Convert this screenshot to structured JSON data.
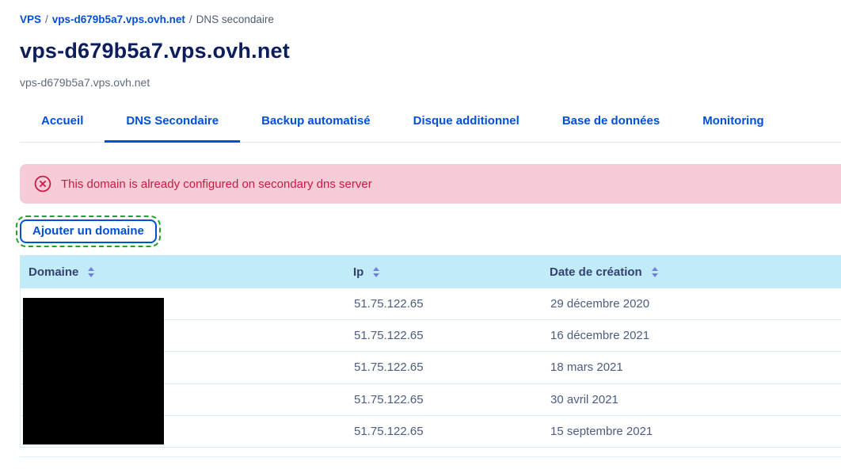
{
  "breadcrumb": {
    "separator": "/",
    "items": [
      {
        "label": "VPS",
        "type": "link"
      },
      {
        "label": "vps-d679b5a7.vps.ovh.net",
        "type": "link"
      },
      {
        "label": "DNS secondaire",
        "type": "current"
      }
    ]
  },
  "header": {
    "title": "vps-d679b5a7.vps.ovh.net",
    "subtitle": "vps-d679b5a7.vps.ovh.net"
  },
  "tabs": [
    {
      "label": "Accueil",
      "active": false
    },
    {
      "label": "DNS Secondaire",
      "active": true
    },
    {
      "label": "Backup automatisé",
      "active": false
    },
    {
      "label": "Disque additionnel",
      "active": false
    },
    {
      "label": "Base de données",
      "active": false
    },
    {
      "label": "Monitoring",
      "active": false
    }
  ],
  "alert": {
    "message": "This domain is already configured on secondary dns server",
    "icon": "error-circle-x-icon",
    "text_color": "#c51b45",
    "background_color": "#f8ccd7"
  },
  "actions": {
    "add_domain_label": "Ajouter un domaine",
    "agent_highlight_color": "#1ea32d",
    "accent_color": "#0050d7"
  },
  "table": {
    "columns": [
      {
        "label": "Domaine",
        "sortable": true
      },
      {
        "label": "Ip",
        "sortable": true
      },
      {
        "label": "Date de création",
        "sortable": true
      }
    ],
    "domain_column_redacted": true,
    "rows": [
      {
        "domain": "",
        "ip": "51.75.122.65",
        "date": "29 décembre 2020"
      },
      {
        "domain": "",
        "ip": "51.75.122.65",
        "date": "16 décembre 2021"
      },
      {
        "domain": "",
        "ip": "51.75.122.65",
        "date": "18 mars 2021"
      },
      {
        "domain": "",
        "ip": "51.75.122.65",
        "date": "30 avril 2021"
      },
      {
        "domain": "",
        "ip": "51.75.122.65",
        "date": "15 septembre 2021"
      }
    ]
  },
  "colors": {
    "link_blue": "#0050d7",
    "title_navy": "#0c1d5e",
    "table_header_bg": "#c2ebf8",
    "table_header_text": "#32416f",
    "row_text": "#4c5c7f",
    "row_border": "#cdeefa",
    "alert_bg": "#f8ccd7",
    "alert_text": "#c51b45"
  }
}
